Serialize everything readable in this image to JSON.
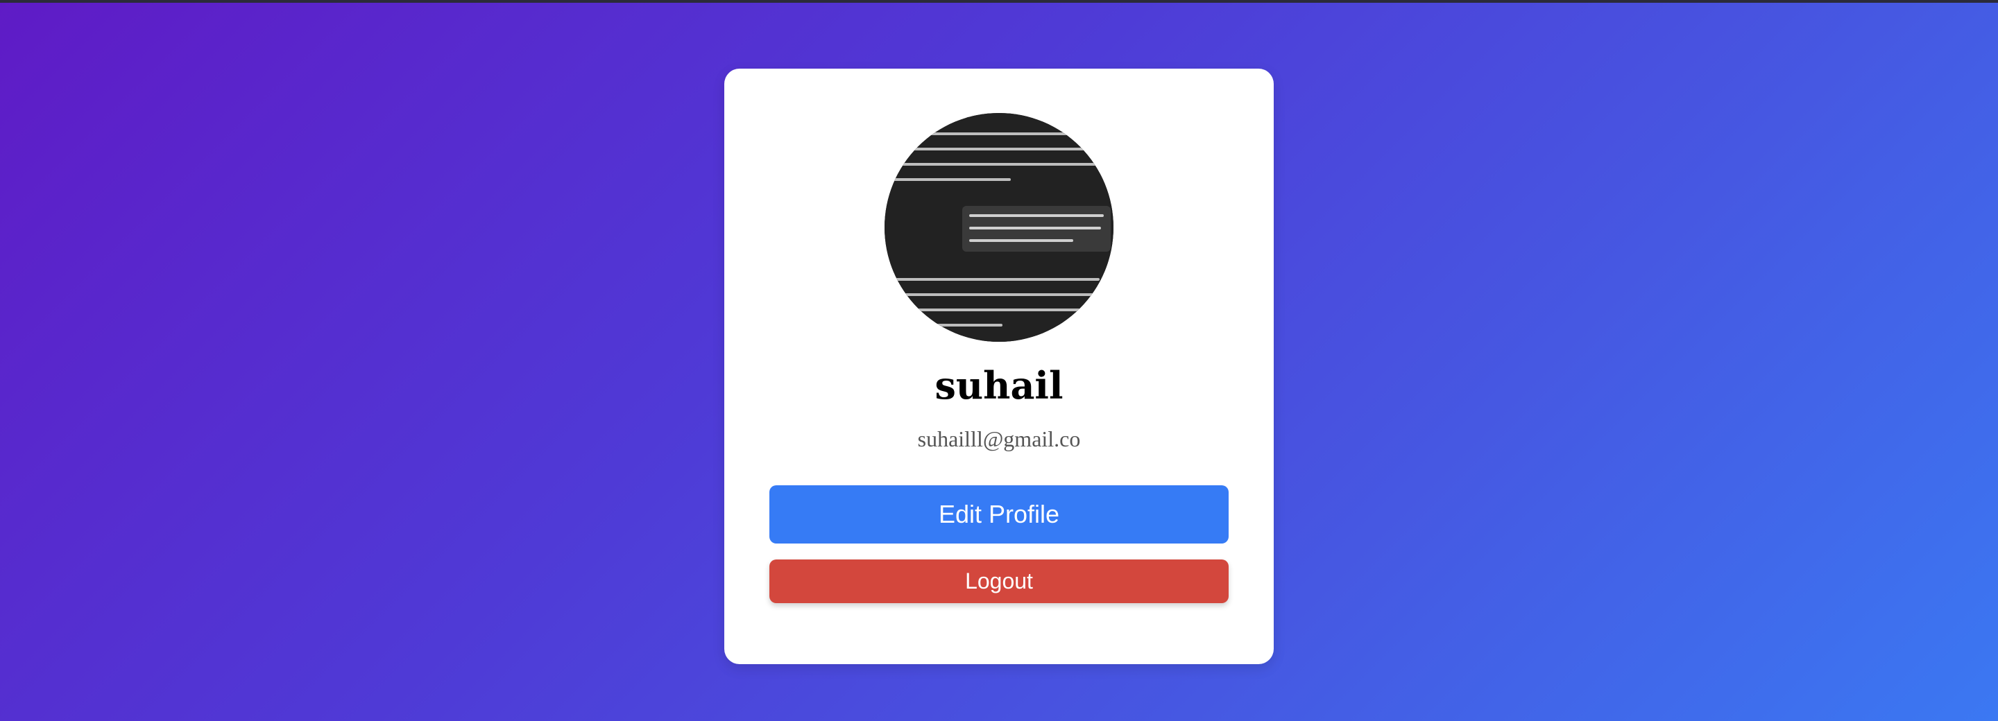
{
  "profile": {
    "name": "suhail",
    "email": "suhailll@gmail.co",
    "avatar": {
      "icon": "profile-photo-screenshot",
      "alt": "profile picture"
    }
  },
  "actions": {
    "edit_label": "Edit Profile",
    "logout_label": "Logout"
  },
  "colors": {
    "gradient_start": "#5f1bc6",
    "gradient_end": "#3b78f2",
    "edit_button": "#367bf5",
    "logout_button": "#d3473d",
    "card": "#ffffff"
  }
}
